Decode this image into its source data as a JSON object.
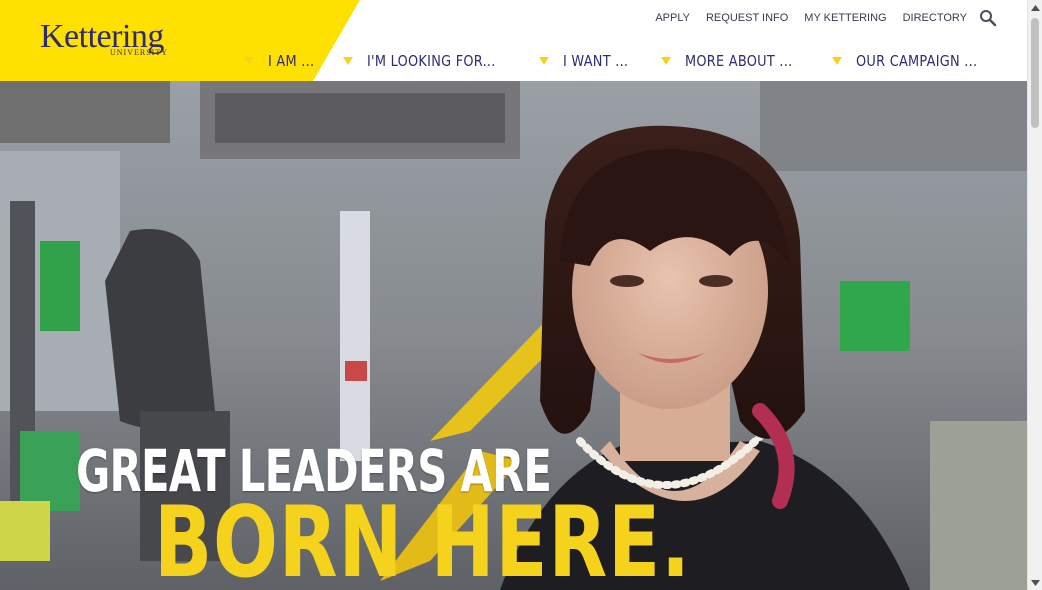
{
  "brand": {
    "name": "Kettering",
    "sub": "UNIVERSITY",
    "colors": {
      "navy": "#2e2b6e",
      "yellow": "#fee100",
      "headline_yellow": "#f5d21c"
    }
  },
  "utility_nav": [
    {
      "label": "APPLY"
    },
    {
      "label": "REQUEST INFO"
    },
    {
      "label": "MY KETTERING"
    },
    {
      "label": "DIRECTORY"
    }
  ],
  "search": {
    "icon": "search-icon"
  },
  "main_nav": [
    {
      "label": "I AM ..."
    },
    {
      "label": "I'M LOOKING FOR..."
    },
    {
      "label": "I WANT ..."
    },
    {
      "label": "MORE ABOUT ..."
    },
    {
      "label": "OUR CAMPAIGN ..."
    }
  ],
  "hero": {
    "headline_line1": "GREAT LEADERS ARE",
    "headline_line2": "BORN HERE."
  }
}
